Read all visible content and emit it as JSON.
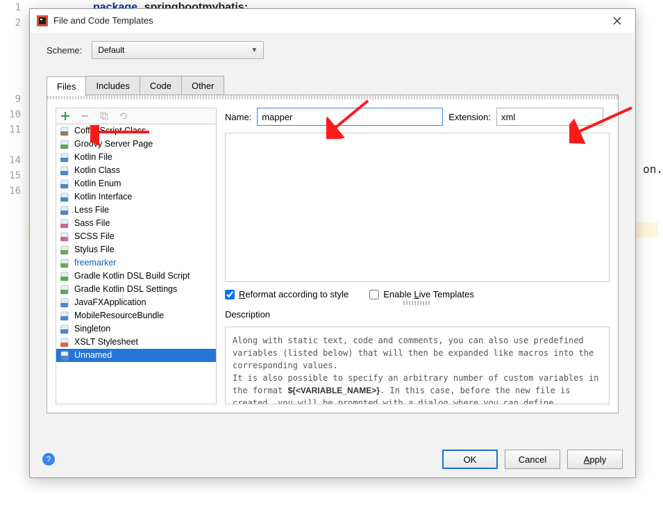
{
  "background": {
    "code_line": {
      "keyword": "package",
      "text": "springbootmybatis;"
    },
    "gutter_lines": [
      "1",
      "2",
      "",
      "",
      "",
      "",
      "9",
      "10",
      "11",
      "",
      "14",
      "15",
      "16"
    ],
    "partial_text": "on."
  },
  "dialog": {
    "title": "File and Code Templates",
    "scheme_label": "Scheme:",
    "scheme_value": "Default",
    "tabs": [
      "Files",
      "Includes",
      "Code",
      "Other"
    ],
    "active_tab": 0,
    "toolbar_icons": [
      "add",
      "remove",
      "copy",
      "refresh"
    ],
    "tree": [
      {
        "label": "CoffeeScript Class",
        "icon": "coffee"
      },
      {
        "label": "Groovy Server Page",
        "icon": "groovy"
      },
      {
        "label": "Kotlin File",
        "icon": "kotlin"
      },
      {
        "label": "Kotlin Class",
        "icon": "kotlin"
      },
      {
        "label": "Kotlin Enum",
        "icon": "kotlin"
      },
      {
        "label": "Kotlin Interface",
        "icon": "kotlin"
      },
      {
        "label": "Less File",
        "icon": "less"
      },
      {
        "label": "Sass File",
        "icon": "sass"
      },
      {
        "label": "SCSS File",
        "icon": "sass"
      },
      {
        "label": "Stylus File",
        "icon": "stylus"
      },
      {
        "label": "freemarker",
        "icon": "freemarker",
        "blue": true
      },
      {
        "label": "Gradle Kotlin DSL Build Script",
        "icon": "gradle"
      },
      {
        "label": "Gradle Kotlin DSL Settings",
        "icon": "gradle"
      },
      {
        "label": "JavaFXApplication",
        "icon": "file"
      },
      {
        "label": "MobileResourceBundle",
        "icon": "file"
      },
      {
        "label": "Singleton",
        "icon": "file"
      },
      {
        "label": "XSLT Stylesheet",
        "icon": "xslt"
      },
      {
        "label": "Unnamed",
        "icon": "file",
        "selected": true
      }
    ],
    "name_label": "Name:",
    "name_value": "mapper",
    "ext_label": "Extension:",
    "ext_value": "xml",
    "reformat_label": "Reformat according to style",
    "reformat_checked": true,
    "live_templates_label": "Enable Live Templates",
    "live_templates_checked": false,
    "description_label": "Description",
    "description_html": "Along with static text, code and comments, you can also use predefined variables (listed below) that will then be expanded like macros into the corresponding values.<br>It is also possible to specify an arbitrary number of custom variables in the format <b>${&lt;VARIABLE_NAME&gt;}</b>. In this case, before the new file is created, you will be prompted with a dialog where you can define particular values for",
    "footer": {
      "ok": "OK",
      "cancel": "Cancel",
      "apply": "Apply"
    }
  },
  "icon_colors": {
    "coffee": "#9a7b4f",
    "groovy": "#5fa84e",
    "kotlin": "#4a88c7",
    "less": "#4a88c7",
    "sass": "#c66a8b",
    "stylus": "#6fa84e",
    "freemarker": "#6fa84e",
    "gradle": "#5fa84e",
    "file": "#4a88c7",
    "xslt": "#d56b3e"
  }
}
